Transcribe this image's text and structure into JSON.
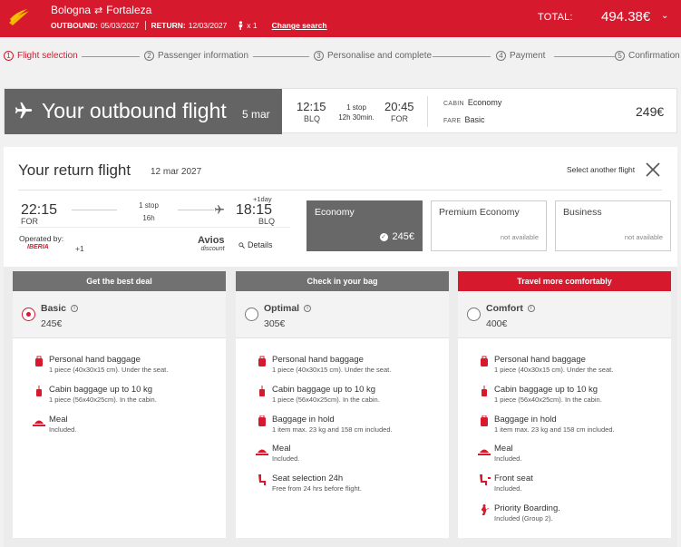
{
  "colors": {
    "brand_red": "#d7192d",
    "dark_grey": "#646464"
  },
  "header": {
    "origin": "Bologna",
    "destination": "Fortaleza",
    "outbound_label": "OUTBOUND:",
    "outbound_date": "05/03/2027",
    "return_label": "RETURN:",
    "return_date": "12/03/2027",
    "passengers": "x 1",
    "change_search": "Change search",
    "total_label": "TOTAL:",
    "total_value": "494.38€"
  },
  "steps": [
    {
      "num": "1",
      "label": "Flight selection"
    },
    {
      "num": "2",
      "label": "Passenger information"
    },
    {
      "num": "3",
      "label": "Personalise and complete"
    },
    {
      "num": "4",
      "label": "Payment"
    },
    {
      "num": "5",
      "label": "Confirmation"
    }
  ],
  "outbound": {
    "title": "Your outbound flight",
    "date": "5 mar",
    "dep_time": "12:15",
    "dep_code": "BLQ",
    "stops": "1 stop",
    "duration": "12h 30min.",
    "arr_time": "20:45",
    "arr_code": "FOR",
    "cabin_label": "CABIN",
    "cabin_value": "Economy",
    "fare_label": "FARE",
    "fare_value": "Basic",
    "price": "249€"
  },
  "return": {
    "title": "Your return flight",
    "date": "12 mar 2027",
    "select_another": "Select another flight",
    "dep_time": "22:15",
    "dep_code": "FOR",
    "stops": "1 stop",
    "duration": "16h",
    "plus_day": "+1day",
    "arr_time": "18:15",
    "arr_code": "BLQ",
    "operated_by": "Operated by:",
    "operator": "IBERIA",
    "operator_more": "+1",
    "avios": "Avios",
    "avios_sub": "discount",
    "details": "Details",
    "cabins": [
      {
        "name": "Economy",
        "price": "245€"
      },
      {
        "name": "Premium Economy",
        "status": "not available"
      },
      {
        "name": "Business",
        "status": "not available"
      }
    ]
  },
  "fares": [
    {
      "header": "Get the best deal",
      "name": "Basic",
      "price": "245€",
      "selected": true,
      "features": [
        {
          "icon": "hand-baggage-icon",
          "title": "Personal hand baggage",
          "desc": "1 piece (40x30x15 cm). Under the seat."
        },
        {
          "icon": "cabin-baggage-icon",
          "title": "Cabin baggage up to 10 kg",
          "desc": "1 piece (56x40x25cm). In the cabin."
        },
        {
          "icon": "meal-icon",
          "title": "Meal",
          "desc": "Included."
        }
      ]
    },
    {
      "header": "Check in your bag",
      "name": "Optimal",
      "price": "305€",
      "selected": false,
      "features": [
        {
          "icon": "hand-baggage-icon",
          "title": "Personal hand baggage",
          "desc": "1 piece (40x30x15 cm). Under the seat."
        },
        {
          "icon": "cabin-baggage-icon",
          "title": "Cabin baggage up to 10 kg",
          "desc": "1 piece (56x40x25cm). In the cabin."
        },
        {
          "icon": "hold-baggage-icon",
          "title": "Baggage in hold",
          "desc": "1 item max. 23 kg and 158 cm included."
        },
        {
          "icon": "meal-icon",
          "title": "Meal",
          "desc": "Included."
        },
        {
          "icon": "seat-icon",
          "title": "Seat selection 24h",
          "desc": "Free from 24 hrs before flight."
        }
      ]
    },
    {
      "header": "Travel more comfortably",
      "name": "Comfort",
      "price": "400€",
      "selected": false,
      "features": [
        {
          "icon": "hand-baggage-icon",
          "title": "Personal hand baggage",
          "desc": "1 piece (40x30x15 cm). Under the seat."
        },
        {
          "icon": "cabin-baggage-icon",
          "title": "Cabin baggage up to 10 kg",
          "desc": "1 piece (56x40x25cm). In the cabin."
        },
        {
          "icon": "hold-baggage-icon",
          "title": "Baggage in hold",
          "desc": "1 item max. 23 kg and 158 cm included."
        },
        {
          "icon": "meal-icon",
          "title": "Meal",
          "desc": "Included."
        },
        {
          "icon": "front-seat-icon",
          "title": "Front seat",
          "desc": "Included."
        },
        {
          "icon": "priority-boarding-icon",
          "title": "Priority Boarding.",
          "desc": "Included (Group 2)."
        }
      ]
    }
  ]
}
